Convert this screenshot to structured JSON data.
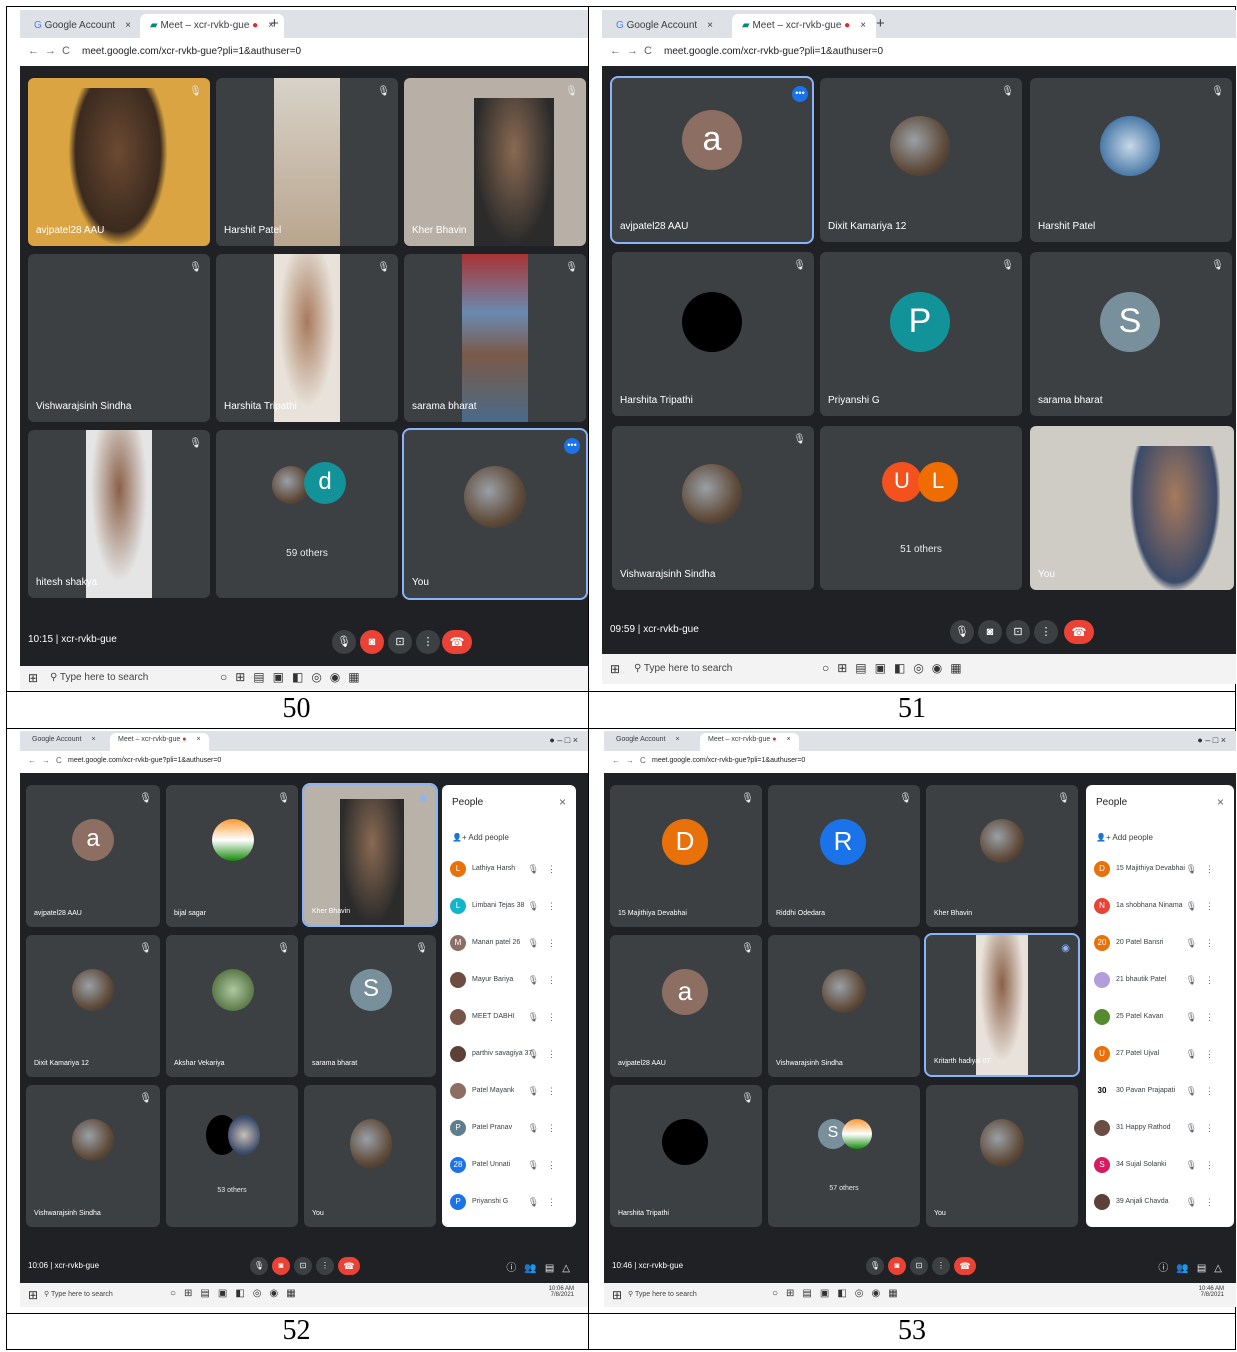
{
  "panels": [
    {
      "caption": "50",
      "tab1": "Google Account",
      "tab2": "Meet – xcr-rvkb-gue",
      "url": "meet.google.com/xcr-rvkb-gue?pli=1&authuser=0",
      "tiles": [
        "avjpatel28 AAU",
        "Harshit Patel",
        "Kher Bhavin",
        "Vishwarajsinh Sindha",
        "Harshita Tripathi",
        "sarama bharat",
        "hitesh shakya",
        "",
        "You"
      ],
      "others_label": "59 others",
      "others_letter": "d",
      "time": "10:15",
      "meeting_code": "xcr-rvkb-gue",
      "search_placeholder": "Type here to search"
    },
    {
      "caption": "51",
      "tab1": "Google Account",
      "tab2": "Meet – xcr-rvkb-gue",
      "url": "meet.google.com/xcr-rvkb-gue?pli=1&authuser=0",
      "tiles": [
        "avjpatel28 AAU",
        "Dixit Kamariya 12",
        "Harshit Patel",
        "Harshita Tripathi",
        "Priyanshi G",
        "sarama bharat",
        "Vishwarajsinh Sindha",
        "",
        "You"
      ],
      "avatar_letters": [
        "a",
        "P",
        "S",
        "U",
        "L"
      ],
      "others_label": "51 others",
      "time": "09:59",
      "meeting_code": "xcr-rvkb-gue",
      "search_placeholder": "Type here to search"
    },
    {
      "caption": "52",
      "tab1": "Google Account",
      "tab2": "Meet – xcr-rvkb-gue",
      "url": "meet.google.com/xcr-rvkb-gue?pli=1&authuser=0",
      "tiles": [
        "avjpatel28 AAU",
        "bijal sagar",
        "Kher Bhavin",
        "Dixit Kamariya 12",
        "Akshar Vekariya",
        "sarama bharat",
        "Vishwarajsinh Sindha",
        "",
        "You"
      ],
      "avatar_letters": [
        "a",
        "S"
      ],
      "others_label": "53 others",
      "time": "10:06",
      "meeting_code": "xcr-rvkb-gue",
      "people_title": "People",
      "add_people": "Add people",
      "people": [
        {
          "initial": "L",
          "name": "Lathiya Harsh",
          "color": "#e8710a"
        },
        {
          "initial": "L",
          "name": "Limbani Tejas 38",
          "color": "#12b5cb"
        },
        {
          "initial": "M",
          "name": "Manan patel 26",
          "color": "#8d6e63"
        },
        {
          "initial": "",
          "name": "Mayur Bariya",
          "color": "#6d4c41"
        },
        {
          "initial": "",
          "name": "MEET DABHI",
          "color": "#795548"
        },
        {
          "initial": "",
          "name": "parthiv savagiya 37",
          "color": "#5d4037"
        },
        {
          "initial": "",
          "name": "Patel Mayank",
          "color": "#8d6e63"
        },
        {
          "initial": "P",
          "name": "Patel Pranav",
          "color": "#607d8b"
        },
        {
          "initial": "28",
          "name": "Patel Unnati",
          "color": "#1a73e8"
        },
        {
          "initial": "P",
          "name": "Priyanshi G",
          "color": "#1a73e8"
        }
      ],
      "search_placeholder": "Type here to search",
      "sys_time": "10:06 AM",
      "sys_date": "7/8/2021"
    },
    {
      "caption": "53",
      "tab1": "Google Account",
      "tab2": "Meet – xcr-rvkb-gue",
      "url": "meet.google.com/xcr-rvkb-gue?pli=1&authuser=0",
      "tiles": [
        "15 Majithiya Devabhai",
        "Riddhi Odedara",
        "Kher Bhavin",
        "avjpatel28 AAU",
        "Vishwarajsinh Sindha",
        "Kritarth hadiyal 07",
        "Harshita Tripathi",
        "",
        "You"
      ],
      "avatar_letters": [
        "D",
        "R",
        "a",
        "S"
      ],
      "others_label": "57 others",
      "time": "10:46",
      "meeting_code": "xcr-rvkb-gue",
      "people_title": "People",
      "add_people": "Add people",
      "people": [
        {
          "initial": "D",
          "name": "15 Majithiya Devabhai",
          "color": "#e8710a"
        },
        {
          "initial": "N",
          "name": "1a shobhana Ninama",
          "color": "#ea4335"
        },
        {
          "initial": "20",
          "name": "20 Patel Bansri",
          "color": "#e8710a"
        },
        {
          "initial": "",
          "name": "21 bhautik Patel",
          "color": "#b39ddb"
        },
        {
          "initial": "",
          "name": "25 Patel Kavan",
          "color": "#558b2f"
        },
        {
          "initial": "U",
          "name": "27 Patel Ujval",
          "color": "#e8710a"
        },
        {
          "initial": "30",
          "name": "30 Pavan Prajapati",
          "color": "#ffffff"
        },
        {
          "initial": "",
          "name": "31 Happy Rathod",
          "color": "#6d4c41"
        },
        {
          "initial": "S",
          "name": "34 Sujal Solanki",
          "color": "#d81b60"
        },
        {
          "initial": "",
          "name": "39 Anjali Chavda",
          "color": "#5d4037"
        }
      ],
      "search_placeholder": "Type here to search",
      "sys_time": "10:46 AM",
      "sys_date": "7/8/2021"
    }
  ]
}
